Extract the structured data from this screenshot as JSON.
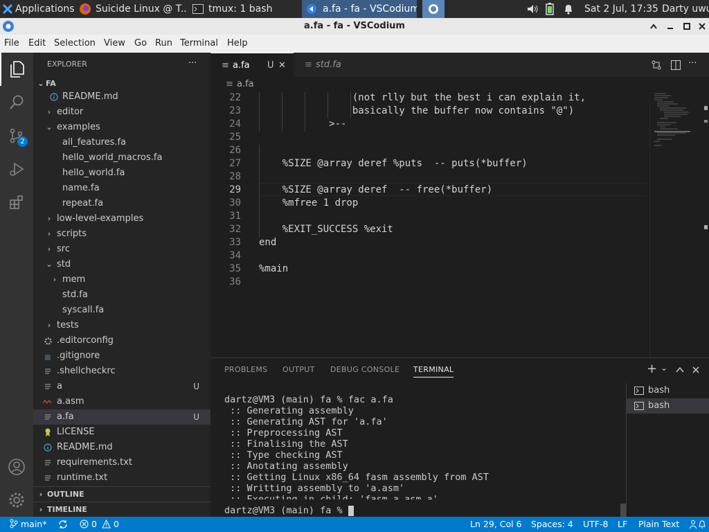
{
  "system_panel": {
    "applications_label": "Applications",
    "tasks": [
      {
        "label": "Suicide Linux @ T..."
      },
      {
        "label": "tmux: 1 bash"
      },
      {
        "label": "a.fa - fa - VSCodium"
      }
    ],
    "clock": "Sat  2 Jul, 17:35",
    "user": "Darty uwu"
  },
  "window": {
    "title": "a.fa - fa - VSCodium"
  },
  "menu": [
    "File",
    "Edit",
    "Selection",
    "View",
    "Go",
    "Run",
    "Terminal",
    "Help"
  ],
  "activity": {
    "scm_badge": "2"
  },
  "explorer": {
    "header": "EXPLORER",
    "more": "···",
    "root": "FA",
    "rows": [
      {
        "label": "README.md",
        "badge": ""
      },
      {
        "label": "editor",
        "badge": ""
      },
      {
        "label": "examples",
        "badge": ""
      },
      {
        "label": "all_features.fa",
        "badge": ""
      },
      {
        "label": "hello_world_macros.fa",
        "badge": ""
      },
      {
        "label": "hello_world.fa",
        "badge": ""
      },
      {
        "label": "name.fa",
        "badge": ""
      },
      {
        "label": "repeat.fa",
        "badge": ""
      },
      {
        "label": "low-level-examples",
        "badge": ""
      },
      {
        "label": "scripts",
        "badge": ""
      },
      {
        "label": "src",
        "badge": ""
      },
      {
        "label": "std",
        "badge": ""
      },
      {
        "label": "mem",
        "badge": ""
      },
      {
        "label": "std.fa",
        "badge": ""
      },
      {
        "label": "syscall.fa",
        "badge": ""
      },
      {
        "label": "tests",
        "badge": ""
      },
      {
        "label": ".editorconfig",
        "badge": ""
      },
      {
        "label": ".gitignore",
        "badge": ""
      },
      {
        "label": ".shellcheckrc",
        "badge": ""
      },
      {
        "label": "a",
        "badge": "U"
      },
      {
        "label": "a.asm",
        "badge": ""
      },
      {
        "label": "a.fa",
        "badge": "U"
      },
      {
        "label": "LICENSE",
        "badge": ""
      },
      {
        "label": "README.md",
        "badge": ""
      },
      {
        "label": "requirements.txt",
        "badge": ""
      },
      {
        "label": "runtime.txt",
        "badge": ""
      }
    ],
    "outline": "OUTLINE",
    "timeline": "TIMELINE"
  },
  "editor": {
    "tabs": [
      {
        "label": "a.fa",
        "badge": "U"
      },
      {
        "label": "std.fa",
        "badge": ""
      }
    ],
    "breadcrumb": "a.fa",
    "lines": [
      {
        "n": "22",
        "text": "                (not rlly but the best i can explain it,"
      },
      {
        "n": "23",
        "text": "                basically the buffer now contains \"@\")"
      },
      {
        "n": "24",
        "text": "            >--"
      },
      {
        "n": "25",
        "text": ""
      },
      {
        "n": "26",
        "text": ""
      },
      {
        "n": "27",
        "text": "    %SIZE @array deref %puts  -- puts(*buffer)"
      },
      {
        "n": "28",
        "text": ""
      },
      {
        "n": "29",
        "text": "    %SIZE @array deref  -- free(*buffer)"
      },
      {
        "n": "30",
        "text": "    %mfree 1 drop"
      },
      {
        "n": "31",
        "text": ""
      },
      {
        "n": "32",
        "text": "    %EXIT_SUCCESS %exit"
      },
      {
        "n": "33",
        "text": "end"
      },
      {
        "n": "34",
        "text": ""
      },
      {
        "n": "35",
        "text": "%main"
      },
      {
        "n": "36",
        "text": ""
      }
    ]
  },
  "panel": {
    "tabs": [
      "PROBLEMS",
      "OUTPUT",
      "DEBUG CONSOLE",
      "TERMINAL"
    ],
    "terminal_lines": [
      "dartz@VM3 (main) fa % fac a.fa",
      " :: Generating assembly",
      " :: Generating AST for 'a.fa'",
      " :: Preprocessing AST",
      " :: Finalising the AST",
      " :: Type checking AST",
      " :: Anotating assembly",
      " :: Getting Linux x86_64 fasm assembly from AST",
      " :: Writting assembly to 'a.asm'",
      " :: Executing in child: 'fasm a.asm a'"
    ],
    "prompt": "dartz@VM3 (main) fa % ",
    "terminals": [
      "bash",
      "bash"
    ]
  },
  "status": {
    "branch": "main*",
    "errors": "0",
    "warnings": "0",
    "position": "Ln 29, Col 6",
    "spaces": "Spaces: 4",
    "encoding": "UTF-8",
    "eol": "LF",
    "language": "Plain Text"
  }
}
